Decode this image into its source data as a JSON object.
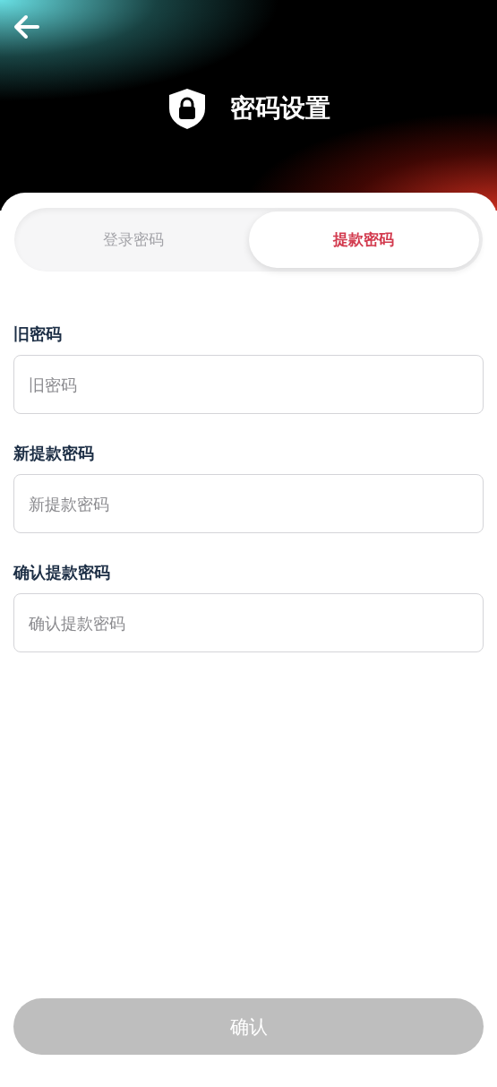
{
  "header": {
    "title": "密码设置"
  },
  "tabs": [
    {
      "label": "登录密码",
      "selected": false
    },
    {
      "label": "提款密码",
      "selected": true
    }
  ],
  "fields": [
    {
      "label": "旧密码",
      "placeholder": "旧密码"
    },
    {
      "label": "新提款密码",
      "placeholder": "新提款密码"
    },
    {
      "label": "确认提款密码",
      "placeholder": "确认提款密码"
    }
  ],
  "submit": {
    "label": "确认",
    "disabled": true
  }
}
